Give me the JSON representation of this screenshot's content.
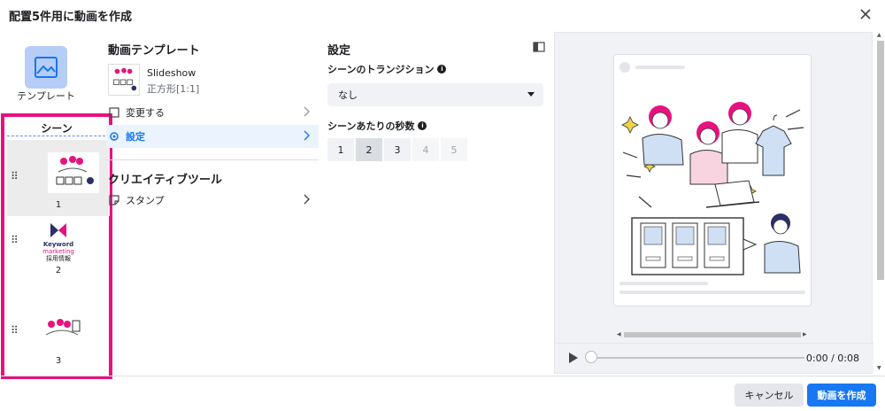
{
  "dialog": {
    "title": "配置5件用に動画を作成"
  },
  "left": {
    "template_label": "テンプレート",
    "scene_header": "シーン",
    "scenes": [
      {
        "number": "1"
      },
      {
        "number": "2",
        "logo_line1": "Keyword",
        "logo_line2": "marketing",
        "logo_line3": "採用情報"
      },
      {
        "number": "3"
      }
    ]
  },
  "middle": {
    "template_section_title": "動画テンプレート",
    "template_name": "Slideshow",
    "template_format": "正方形[1:1]",
    "menu": [
      {
        "label": "変更する"
      },
      {
        "label": "設定"
      }
    ],
    "creative_tools_title": "クリエイティブツール",
    "creative_menu": [
      {
        "label": "スタンプ"
      }
    ]
  },
  "settings": {
    "title": "設定",
    "transition_label": "シーンのトランジション",
    "transition_value": "なし",
    "seconds_label": "シーンあたりの秒数",
    "seconds_options": [
      "1",
      "2",
      "3",
      "4",
      "5"
    ],
    "seconds_selected": "2"
  },
  "preview": {
    "time": "0:00 / 0:08"
  },
  "footer": {
    "cancel_label": "キャンセル",
    "create_label": "動画を作成"
  },
  "colors": {
    "accent": "#1877f2",
    "highlight_box": "#e8117f",
    "brand_pink": "#e8117f",
    "brand_navy": "#2b2f6b"
  }
}
